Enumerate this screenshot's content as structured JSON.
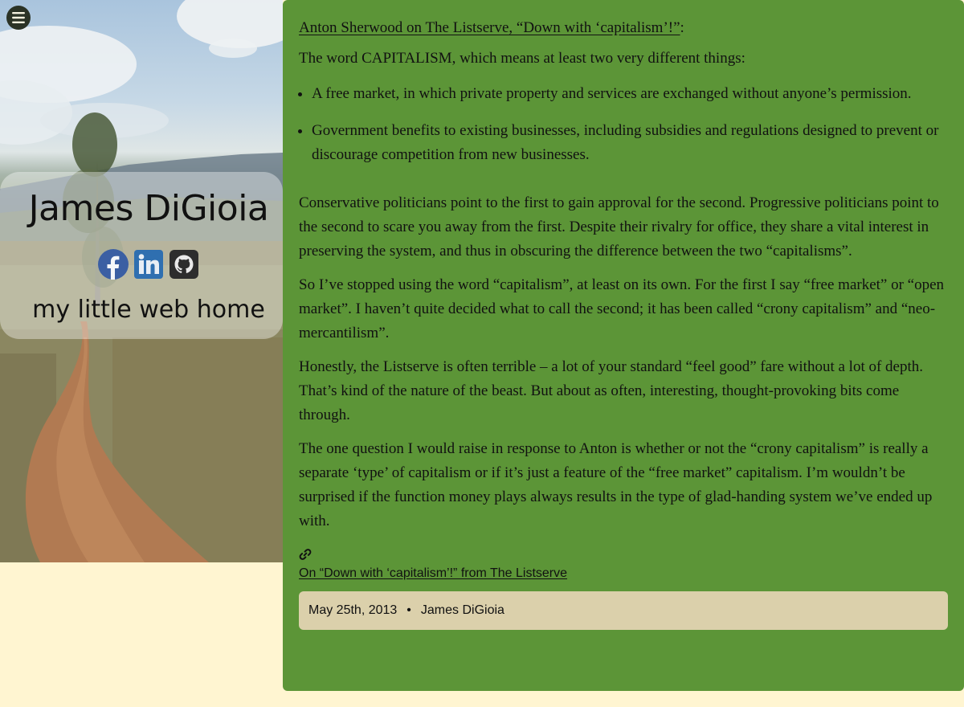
{
  "theme": {
    "page_background": "#fff5d1",
    "post_background": "#5c9537",
    "meta_background": "#dbd0ab"
  },
  "header": {
    "menu_icon": "hamburger-icon",
    "site_name": "James DiGioia",
    "tagline": "my little web home",
    "social": [
      {
        "icon": "facebook-icon",
        "color": "#3b5fa3"
      },
      {
        "icon": "linkedin-icon",
        "color": "#2f6fb0"
      },
      {
        "icon": "github-icon",
        "color": "#2d2d2d"
      }
    ]
  },
  "post": {
    "title_link": "Anton Sherwood on The Listserve, “Down with ‘capitalism’!”",
    "title_suffix": ":",
    "intro": "The word CAPITALISM, which means at least two very different things:",
    "list": [
      "A free market, in which private property and services are exchanged without anyone’s permission.",
      "Government benefits to existing businesses, including subsidies and regulations designed to prevent or discourage competition from new businesses."
    ],
    "paragraphs": [
      "Conservative politicians point to the first to gain approval for the second. Progressive politicians point to the second to scare you away from the first. Despite their rivalry for office, they share a vital interest in preserving the system, and thus in obscuring the difference between the two “capitalisms”.",
      "So I’ve stopped using the word “capitalism”, at least on its own. For the first I say “free market” or “open market”. I haven’t quite decided what to call the second; it has been called “crony capitalism” and “neo-mercantilism”.",
      "Honestly, the Listserve is often terrible – a lot of your standard “feel good” fare without a lot of depth. That’s kind of the nature of the beast. But about as often, interesting, thought-provoking bits come through.",
      "The one question I would raise in response to Anton is whether or not the “crony capitalism” is really a separate ‘type’ of capitalism or if it’s just a feature of the “free market” capitalism. I’m wouldn’t be surprised if the function money plays always results in the type of glad-handing system we’ve ended up with."
    ],
    "permalink_icon": "link-icon",
    "permalink_text": "On “Down with ‘capitalism’!” from The Listserve",
    "date": "May 25th, 2013",
    "separator": "•",
    "author": "James DiGioia"
  }
}
